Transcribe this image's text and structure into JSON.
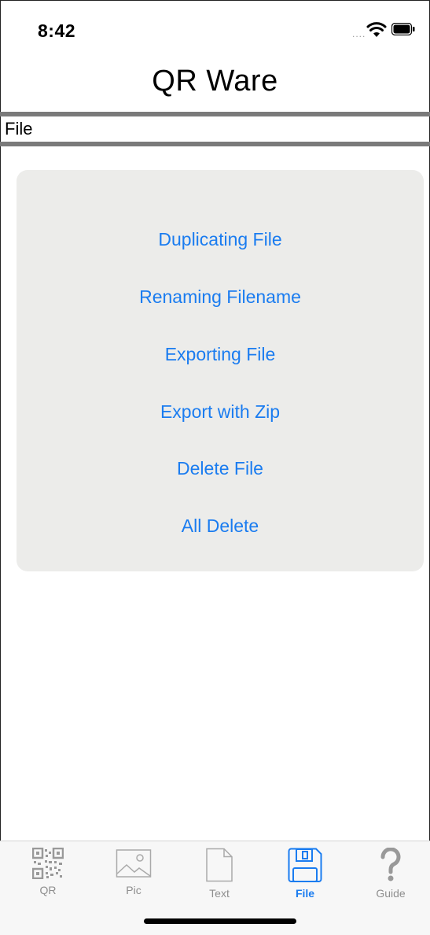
{
  "status_bar": {
    "time": "8:42",
    "signal_dots": "....",
    "wifi_icon": "wifi-icon",
    "battery_icon": "battery-icon"
  },
  "nav": {
    "title": "QR Ware"
  },
  "section": {
    "label": "File"
  },
  "menu": {
    "items": [
      {
        "label": "Duplicating File"
      },
      {
        "label": "Renaming Filename"
      },
      {
        "label": "Exporting File"
      },
      {
        "label": "Export with Zip"
      },
      {
        "label": "Delete File"
      },
      {
        "label": "All Delete"
      }
    ]
  },
  "tab_bar": {
    "tabs": [
      {
        "label": "QR",
        "icon": "qr-code-icon",
        "active": false
      },
      {
        "label": "Pic",
        "icon": "picture-icon",
        "active": false
      },
      {
        "label": "Text",
        "icon": "document-icon",
        "active": false
      },
      {
        "label": "File",
        "icon": "floppy-disk-icon",
        "active": true
      },
      {
        "label": "Guide",
        "icon": "question-mark-icon",
        "active": false
      }
    ]
  },
  "colors": {
    "accent": "#1a7cf0",
    "card_background": "#ececea",
    "rule": "#7a7a7a",
    "inactive_tab": "#8e8e8e"
  }
}
